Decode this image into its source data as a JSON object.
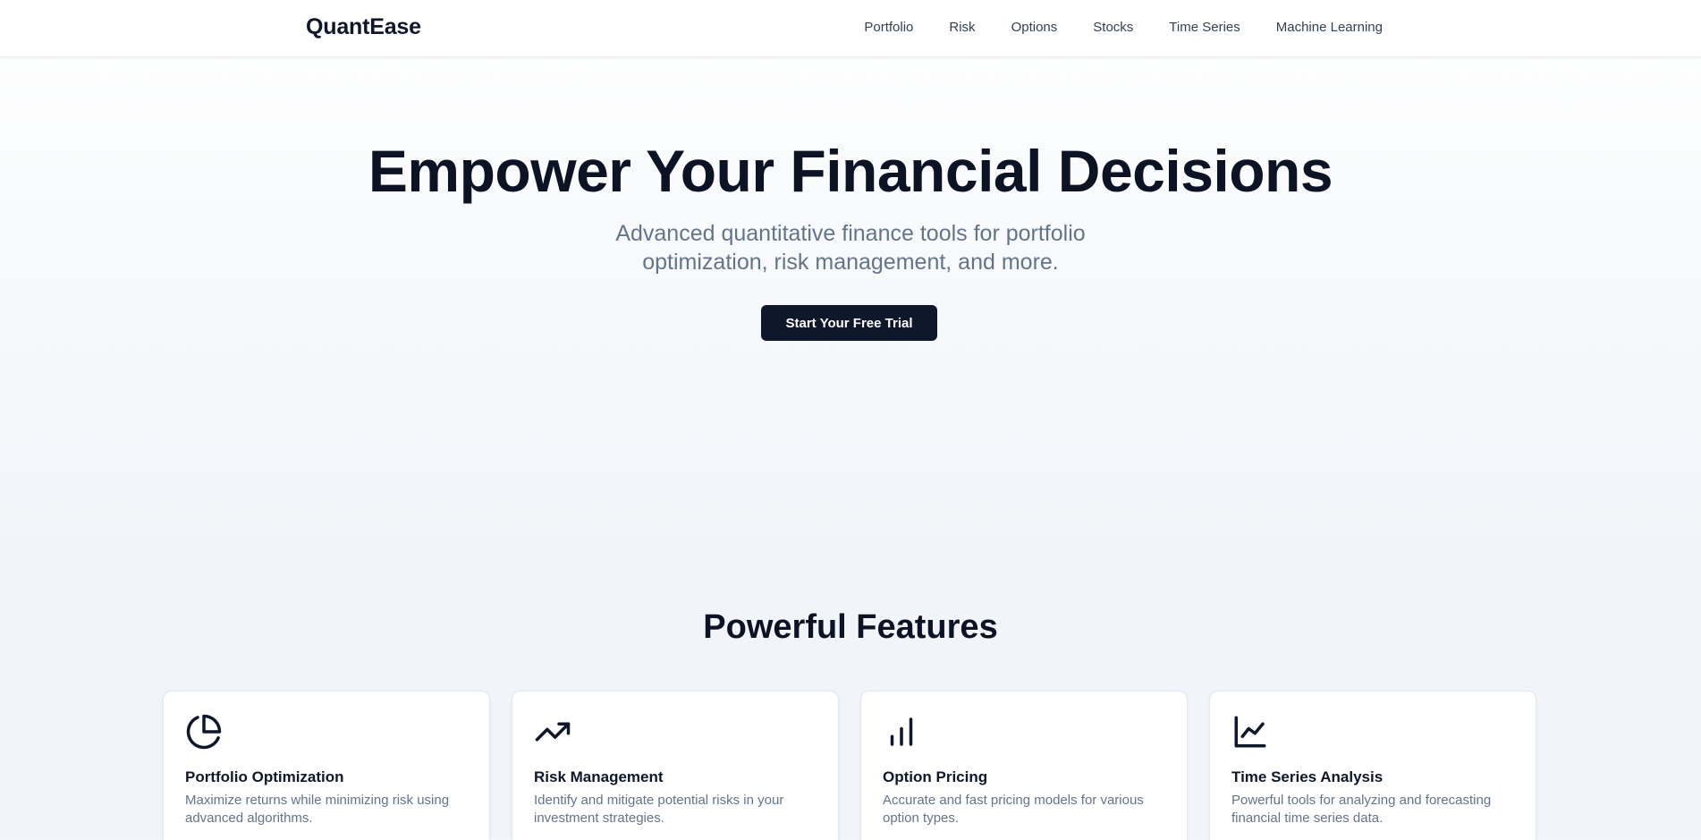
{
  "header": {
    "logo": "QuantEase",
    "nav": [
      {
        "label": "Portfolio"
      },
      {
        "label": "Risk"
      },
      {
        "label": "Options"
      },
      {
        "label": "Stocks"
      },
      {
        "label": "Time Series"
      },
      {
        "label": "Machine Learning"
      }
    ]
  },
  "hero": {
    "title": "Empower Your Financial Decisions",
    "subtitle": "Advanced quantitative finance tools for portfolio optimization, risk management, and more.",
    "cta_label": "Start Your Free Trial"
  },
  "features": {
    "title": "Powerful Features",
    "cards": [
      {
        "icon": "pie-chart-icon",
        "title": "Portfolio Optimization",
        "desc": "Maximize returns while minimizing risk using advanced algorithms."
      },
      {
        "icon": "trending-up-icon",
        "title": "Risk Management",
        "desc": "Identify and mitigate potential risks in your investment strategies."
      },
      {
        "icon": "bar-chart-icon",
        "title": "Option Pricing",
        "desc": "Accurate and fast pricing models for various option types."
      },
      {
        "icon": "line-chart-icon",
        "title": "Time Series Analysis",
        "desc": "Powerful tools for analyzing and forecasting financial time series data."
      }
    ]
  },
  "colors": {
    "primary": "#0f172a",
    "muted_text": "#64748b",
    "card_border": "#e2e8f0",
    "background": "#f1f5f9"
  }
}
